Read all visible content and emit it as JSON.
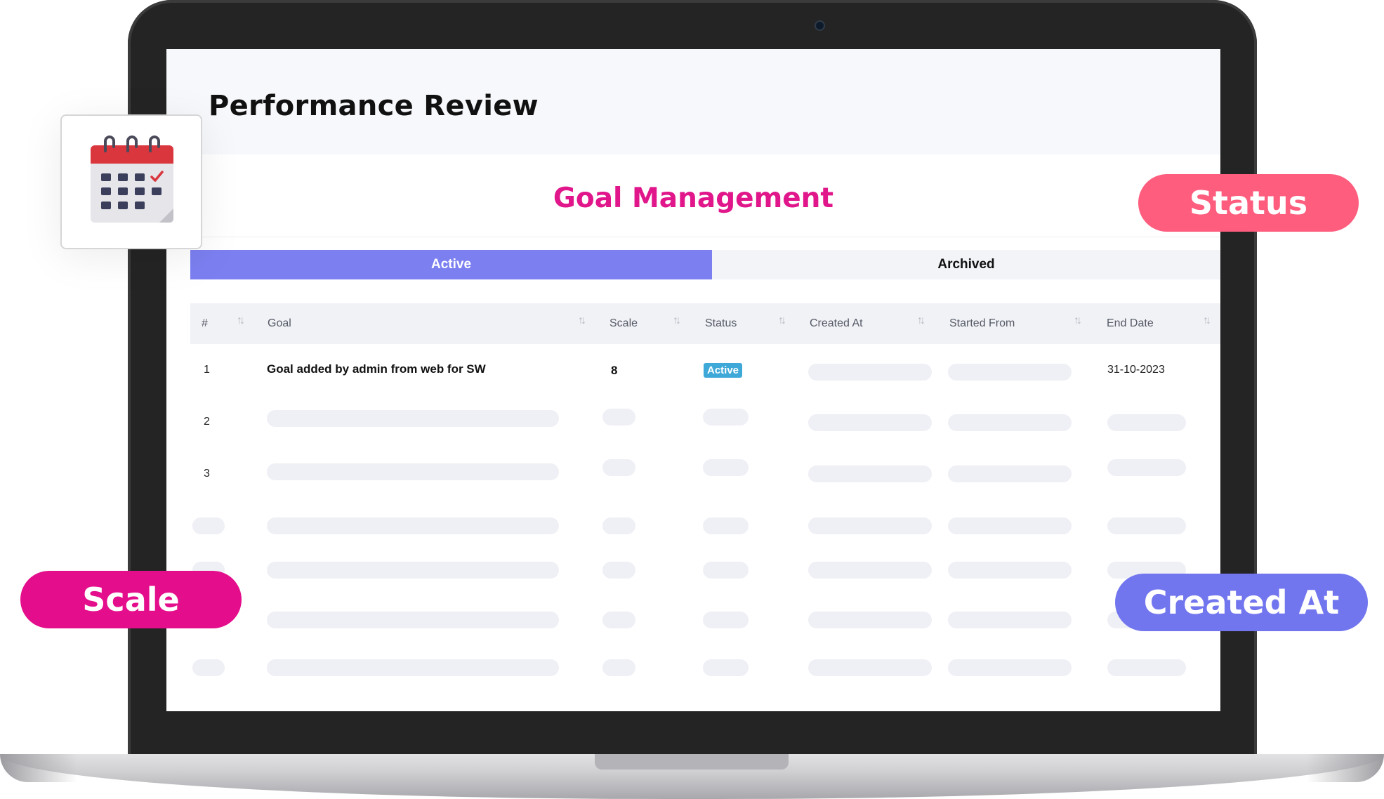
{
  "page": {
    "title": "Performance Review",
    "subtitle": "Goal Management"
  },
  "tabs": [
    {
      "label": "Active",
      "active": true
    },
    {
      "label": "Archived",
      "active": false
    }
  ],
  "table": {
    "columns": [
      "#",
      "Goal",
      "Scale",
      "Status",
      "Created At",
      "Started From",
      "End Date"
    ],
    "rows": [
      {
        "index": "1",
        "goal": "Goal added by admin from web for SW",
        "scale": "8",
        "status": "Active",
        "end_date": "31-10-2023"
      },
      {
        "index": "2"
      },
      {
        "index": "3"
      }
    ]
  },
  "callouts": {
    "status": "Status",
    "scale": "Scale",
    "created_at": "Created At"
  },
  "icons": {
    "calendar": "calendar-icon",
    "sort": "sort-icon"
  },
  "colors": {
    "accent_pink": "#e0168a",
    "tab_active": "#7b7ff0",
    "status_badge": "#3ea8d8",
    "callout_status": "#fe5d7e",
    "callout_scale": "#e40d8b",
    "callout_created": "#7276ee"
  }
}
